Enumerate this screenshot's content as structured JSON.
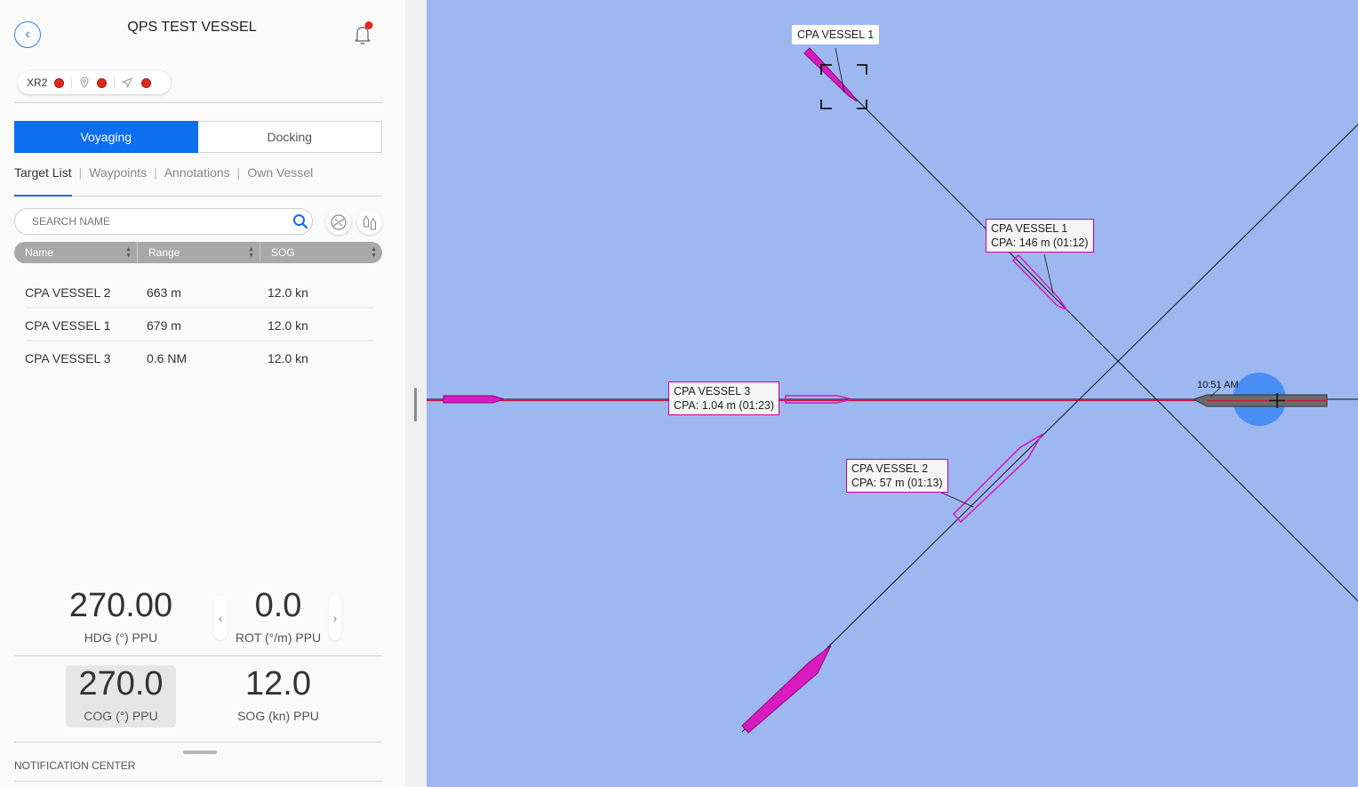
{
  "header": {
    "title": "QPS TEST VESSEL"
  },
  "status_bar": {
    "device_label": "XR2"
  },
  "mode_tabs": [
    {
      "label": "Voyaging",
      "active": true
    },
    {
      "label": "Docking",
      "active": false
    }
  ],
  "sub_tabs": [
    {
      "label": "Target List",
      "active": true
    },
    {
      "label": "Waypoints",
      "active": false
    },
    {
      "label": "Annotations",
      "active": false
    },
    {
      "label": "Own Vessel",
      "active": false
    }
  ],
  "search": {
    "placeholder": "SEARCH NAME",
    "value": ""
  },
  "table": {
    "columns": [
      "Name",
      "Range",
      "SOG"
    ],
    "rows": [
      {
        "name": "CPA VESSEL 2",
        "range": "663 m",
        "sog": "12.0 kn"
      },
      {
        "name": "CPA VESSEL 1",
        "range": "679 m",
        "sog": "12.0 kn"
      },
      {
        "name": "CPA VESSEL 3",
        "range": "0.6 NM",
        "sog": "12.0 kn"
      }
    ]
  },
  "readouts": {
    "hdg": {
      "value": "270.00",
      "label": "HDG (°) PPU"
    },
    "rot": {
      "value": "0.0",
      "label": "ROT (°/m) PPU"
    },
    "cog": {
      "value": "270.0",
      "label": "COG (°) PPU"
    },
    "sog": {
      "value": "12.0",
      "label": "SOG (kn) PPU"
    }
  },
  "footer": {
    "notification_center": "NOTIFICATION CENTER"
  },
  "map": {
    "background_color": "#9db8f1",
    "target_color": "#d81bbf",
    "own_vessel_time": "10:51 AM",
    "labels": {
      "selected_target": "CPA VESSEL 1",
      "cpa1": "CPA VESSEL 1\nCPA: 146 m (01:12)",
      "cpa3": "CPA VESSEL 3\nCPA: 1.04 m (01:23)",
      "cpa2": "CPA VESSEL 2\nCPA: 57 m (01:13)"
    }
  },
  "colors": {
    "accent": "#0e6ef0",
    "status_dot": "#e02a1f"
  }
}
